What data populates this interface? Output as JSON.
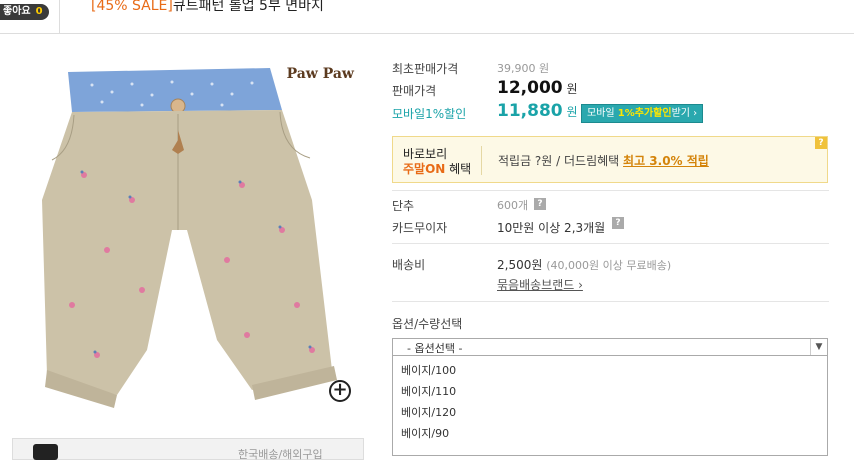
{
  "header": {
    "like_label": "좋아요",
    "like_count": "0",
    "title_sale": "[45% SALE]",
    "title_text": "큐트패턴 롤업 5부 면바지"
  },
  "product": {
    "brand": "Paw Paw",
    "zoom_icon": "plus-circle-icon",
    "thumb_text": "한국배송/해외구입"
  },
  "info": {
    "first_price_label": "최초판매가격",
    "first_price": "39,900 원",
    "sale_price_label": "판매가격",
    "sale_price": "12,000",
    "sale_price_unit": "원",
    "mobile_label": "모바일1%할인",
    "mobile_price": "11,880",
    "mobile_unit": "원",
    "mobile_btn_pre": "모바일 ",
    "mobile_btn_hl": "1%추가할인",
    "mobile_btn_post": "받기 ›"
  },
  "notice": {
    "line1": "바로보리",
    "line2_hl": "주말ON",
    "line2_rest": " 혜택",
    "benefit_text": "적립금 ?원 / 더드림혜택 ",
    "benefit_link": "최고 3.0% 적립",
    "help": "?"
  },
  "details": {
    "unit_label": "단추",
    "unit_value": "600개",
    "card_label": "카드무이자",
    "card_value": "10만원 이상 2,3개월",
    "ship_label": "배송비",
    "ship_value": "2,500원",
    "ship_note": "(40,000원 이상 무료배송)",
    "bundle_link": "묶음배송브랜드 ›",
    "help": "?"
  },
  "options": {
    "label": "옵션/수량선택",
    "selected": "- 옵션선택 -",
    "arrow": "▼",
    "items": [
      "베이지/100",
      "베이지/110",
      "베이지/120",
      "베이지/90"
    ]
  }
}
